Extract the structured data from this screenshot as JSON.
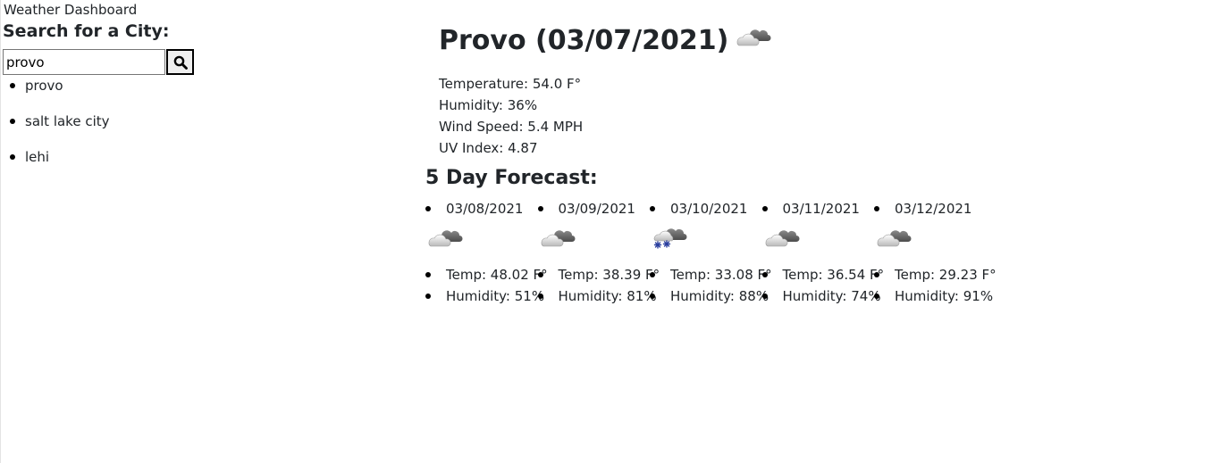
{
  "app": {
    "title": "Weather Dashboard"
  },
  "search": {
    "heading": "Search for a City:",
    "value": "provo",
    "button_icon": "search-icon"
  },
  "history": [
    {
      "label": "provo"
    },
    {
      "label": "salt lake city"
    },
    {
      "label": "lehi"
    }
  ],
  "current": {
    "heading": "Provo (03/07/2021)",
    "icon": "cloudy-icon",
    "temperature": "Temperature: 54.0 F°",
    "humidity": "Humidity: 36%",
    "wind_speed": "Wind Speed: 5.4 MPH",
    "uv_index": "UV Index: 4.87"
  },
  "forecast": {
    "heading": "5 Day Forecast:",
    "days": [
      {
        "date": "03/08/2021",
        "icon": "cloudy-icon",
        "temp": "Temp: 48.02 F°",
        "humidity": "Humidity: 51%"
      },
      {
        "date": "03/09/2021",
        "icon": "cloudy-icon",
        "temp": "Temp: 38.39 F°",
        "humidity": "Humidity: 81%"
      },
      {
        "date": "03/10/2021",
        "icon": "snow-icon",
        "temp": "Temp: 33.08 F°",
        "humidity": "Humidity: 88%"
      },
      {
        "date": "03/11/2021",
        "icon": "cloudy-icon",
        "temp": "Temp: 36.54 F°",
        "humidity": "Humidity: 74%"
      },
      {
        "date": "03/12/2021",
        "icon": "cloudy-icon",
        "temp": "Temp: 29.23 F°",
        "humidity": "Humidity: 91%"
      }
    ]
  }
}
